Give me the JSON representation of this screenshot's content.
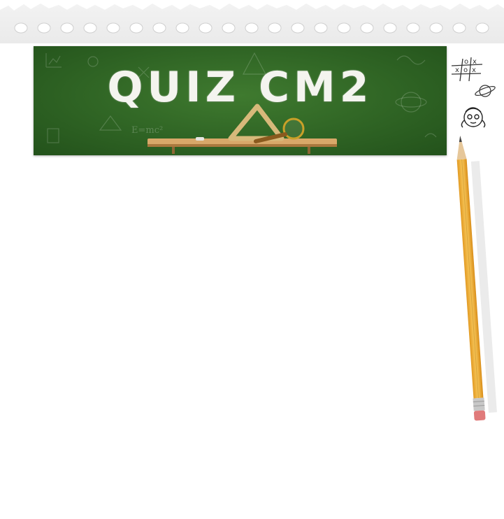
{
  "banner": {
    "title": "QUIZ CM2",
    "chalk_formula": "E=mc²"
  },
  "doodles": {
    "tic_tac_toe_marks": [
      "o",
      "x",
      "x",
      "o",
      "x"
    ]
  },
  "colors": {
    "chalkboard": "#2f6424",
    "chalk": "#f4f4ef",
    "shelf_wood": "#d8a869",
    "pencil_body": "#f0b43a",
    "pencil_eraser": "#e07a7a"
  }
}
